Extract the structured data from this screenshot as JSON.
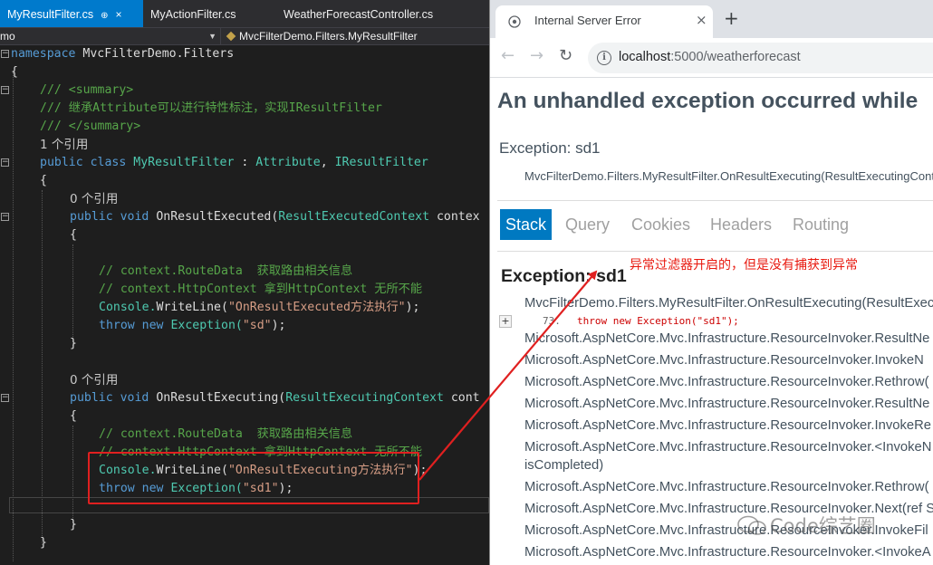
{
  "vs": {
    "tabs": [
      {
        "label": "MyResultFilter.cs",
        "pin": "⊕",
        "close": "×"
      },
      {
        "label": "MyActionFilter.cs"
      },
      {
        "label": "WeatherForecastController.cs"
      }
    ],
    "nav_left": "mo",
    "nav_right": "MvcFilterDemo.Filters.MyResultFilter",
    "code": {
      "l1": "namespace MvcFilterDemo.Filters",
      "l1_kw": "namespace",
      "l1_rest": " MvcFilterDemo.Filters",
      "l2": "{",
      "summary_open": "/// <summary>",
      "summary_text": "/// 继承Attribute可以进行特性标注，实现IResultFilter",
      "summary_close": "/// </summary>",
      "refs_1": "1 个引用",
      "class_public": "public",
      "class_kw": "class",
      "class_name": "MyResultFilter",
      "class_colon": " : ",
      "class_base1": "Attribute",
      "class_comma": ", ",
      "class_base2": "IResultFilter",
      "brace_open": "{",
      "brace_close": "}",
      "refs_0": "0 个引用",
      "m1_public": "public",
      "m1_void": "void",
      "m1_name": "OnResultExecuted(",
      "m1_type": "ResultExecutedContext",
      "m1_param": " contex",
      "m1_c1": "// context.RouteData  获取路由相关信息",
      "m1_c2": "// context.HttpContext 拿到HttpContext 无所不能",
      "m1_console": "Console.",
      "m1_write": "WriteLine(",
      "m1_str": "\"OnResultExecuted方法执行\"",
      "m1_end": ");",
      "m1_throw": "throw",
      "m1_new": "new",
      "m1_exc": "Exception(",
      "m1_str2": "\"sd\"",
      "m2_public": "public",
      "m2_void": "void",
      "m2_name": "OnResultExecuting(",
      "m2_type": "ResultExecutingContext",
      "m2_param": " cont",
      "m2_c1": "// context.RouteData  获取路由相关信息",
      "m2_c2": "// context.HttpContext 拿到HttpContext 无所不能",
      "m2_str": "\"OnResultExecuting方法执行\"",
      "m2_str2": "\"sd1\""
    }
  },
  "browser": {
    "tab_title": "Internal Server Error",
    "tab_close": "×",
    "new_tab": "+",
    "url_host": "localhost",
    "url_rest": ":5000/weatherforecast",
    "heading": "An unhandled exception occurred while",
    "exception_label": "Exception: sd1",
    "exception_location": "MvcFilterDemo.Filters.MyResultFilter.OnResultExecuting(ResultExecutingContext",
    "tabs": [
      "Stack",
      "Query",
      "Cookies",
      "Headers",
      "Routing"
    ],
    "annotation": "异常过滤器开启的，但是没有捕获到异常",
    "stack_heading": "Exception: sd1",
    "stack": [
      "MvcFilterDemo.Filters.MyResultFilter.OnResultExecuting(ResultExecu",
      "Microsoft.AspNetCore.Mvc.Infrastructure.ResourceInvoker.ResultNe",
      "Microsoft.AspNetCore.Mvc.Infrastructure.ResourceInvoker.InvokeN",
      "Microsoft.AspNetCore.Mvc.Infrastructure.ResourceInvoker.Rethrow(",
      "Microsoft.AspNetCore.Mvc.Infrastructure.ResourceInvoker.ResultNe",
      "Microsoft.AspNetCore.Mvc.Infrastructure.ResourceInvoker.InvokeRe",
      "Microsoft.AspNetCore.Mvc.Infrastructure.ResourceInvoker.<InvokeN",
      "isCompleted)",
      "Microsoft.AspNetCore.Mvc.Infrastructure.ResourceInvoker.Rethrow(",
      "Microsoft.AspNetCore.Mvc.Infrastructure.ResourceInvoker.Next(ref S",
      "Microsoft.AspNetCore.Mvc.Infrastructure.ResourceInvoker.InvokeFil",
      "Microsoft.AspNetCore.Mvc.Infrastructure.ResourceInvoker.<InvokeA"
    ],
    "code_num": "73.",
    "code_src": "throw new Exception(\"sd1\");",
    "expand": "+",
    "watermark": "Code综艺圈"
  },
  "colors": {
    "accent": "#007acc",
    "stack_tab": "#0079c1",
    "annotation": "#e8190f",
    "box": "#e02020"
  }
}
